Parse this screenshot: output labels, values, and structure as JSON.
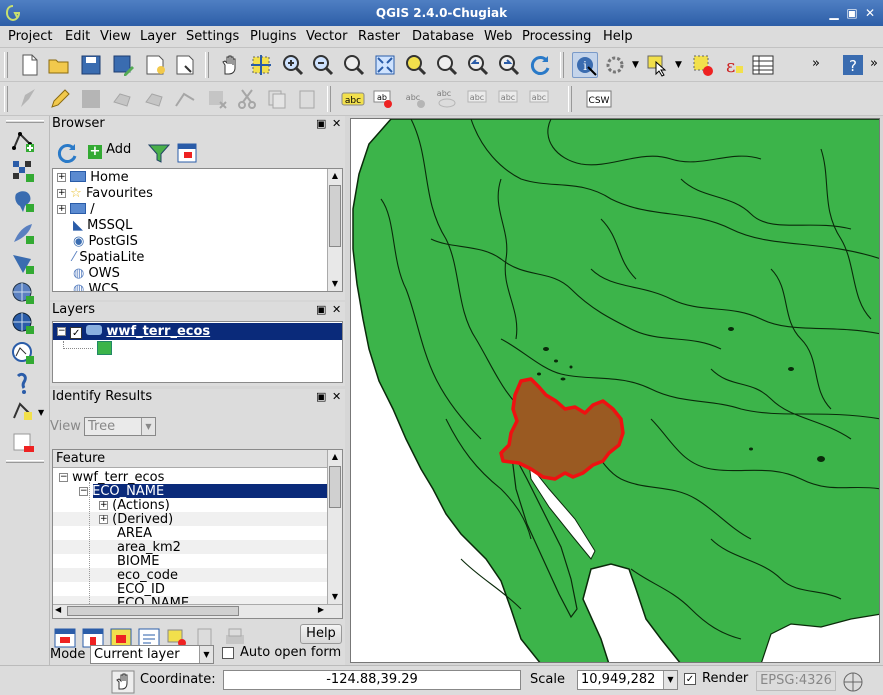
{
  "window": {
    "title": "QGIS 2.4.0-Chugiak"
  },
  "menu": [
    "Project",
    "Edit",
    "View",
    "Layer",
    "Settings",
    "Plugins",
    "Vector",
    "Raster",
    "Database",
    "Web",
    "Processing",
    "Help"
  ],
  "toolbar2": {
    "csw_label": "CSW"
  },
  "browser": {
    "title": "Browser",
    "add_label": "Add",
    "items": [
      "Home",
      "Favourites",
      "/",
      "MSSQL",
      "PostGIS",
      "SpatiaLite",
      "OWS",
      "WCS"
    ]
  },
  "layers": {
    "title": "Layers",
    "layer_name": "wwf_terr_ecos",
    "fill_color": "#3cb44a"
  },
  "identify": {
    "title": "Identify Results",
    "view_label": "View",
    "view_value": "Tree",
    "feature_header": "Feature",
    "tree": [
      "wwf_terr_ecos",
      "ECO_NAME",
      "(Actions)",
      "(Derived)",
      "AREA",
      "area_km2",
      "BIOME",
      "eco_code",
      "ECO_ID",
      "ECO_NAME"
    ],
    "help_label": "Help",
    "mode_label": "Mode",
    "mode_value": "Current layer",
    "auto_open_label": "Auto open form"
  },
  "status": {
    "coordinate_label": "Coordinate:",
    "coordinate_value": "-124.88,39.29",
    "scale_label": "Scale",
    "scale_value": "10,949,282",
    "render_label": "Render",
    "crs_label": "EPSG:4326"
  },
  "colors": {
    "land": "#3cb44a",
    "selected_fill": "#9a5a22",
    "selected_outline": "#ee1111",
    "water": "#ffffff"
  }
}
